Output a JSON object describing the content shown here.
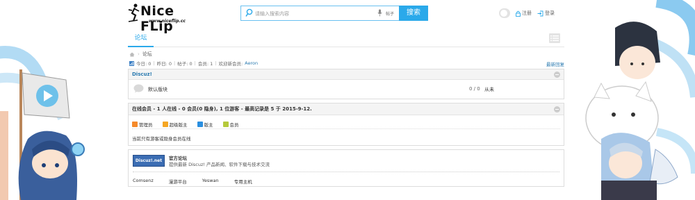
{
  "header": {
    "logo_text": "Nice FLip",
    "logo_url": "www.niceflip.cc",
    "search_placeholder": "请输入搜索内容",
    "search_type": "帖子",
    "search_button": "搜索",
    "register": "注册",
    "login": "登录"
  },
  "nav": {
    "tab_forum": "论坛"
  },
  "breadcrumb": {
    "current": "论坛"
  },
  "stats": {
    "today": "今日: 0",
    "yesterday": "昨日: 0",
    "posts": "帖子: 0",
    "members": "会员: 1",
    "welcome": "欢迎新会员:",
    "new_member": "Aeron",
    "latest_reply": "最新回复"
  },
  "category": {
    "title": "Discuz!",
    "forum_name": "默认版块",
    "forum_count": "0 / 0",
    "forum_last": "从未"
  },
  "online": {
    "title": "在线会员 - 1 人在线 - 0 会员(0 隐身), 1 位游客 - 最高记录是 5 于 2015-9-12.",
    "legend": [
      {
        "label": "管理员",
        "color": "#f58a2a"
      },
      {
        "label": "超级版主",
        "color": "#f5a623"
      },
      {
        "label": "版主",
        "color": "#2a8fe0"
      },
      {
        "label": "会员",
        "color": "#b5c93b"
      }
    ],
    "message": "当前只有游客或隐身会员在线"
  },
  "partner": {
    "logo_text": "Discuz!.net",
    "title": "官方论坛",
    "desc": "提供最新 Discuz! 产品新闻、软件下载与技术交流",
    "links": [
      "Comsenz",
      "漫游平台",
      "Yeswan",
      "专用主机"
    ]
  },
  "colors": {
    "accent": "#2aa9ea",
    "link": "#2a7ab0"
  }
}
